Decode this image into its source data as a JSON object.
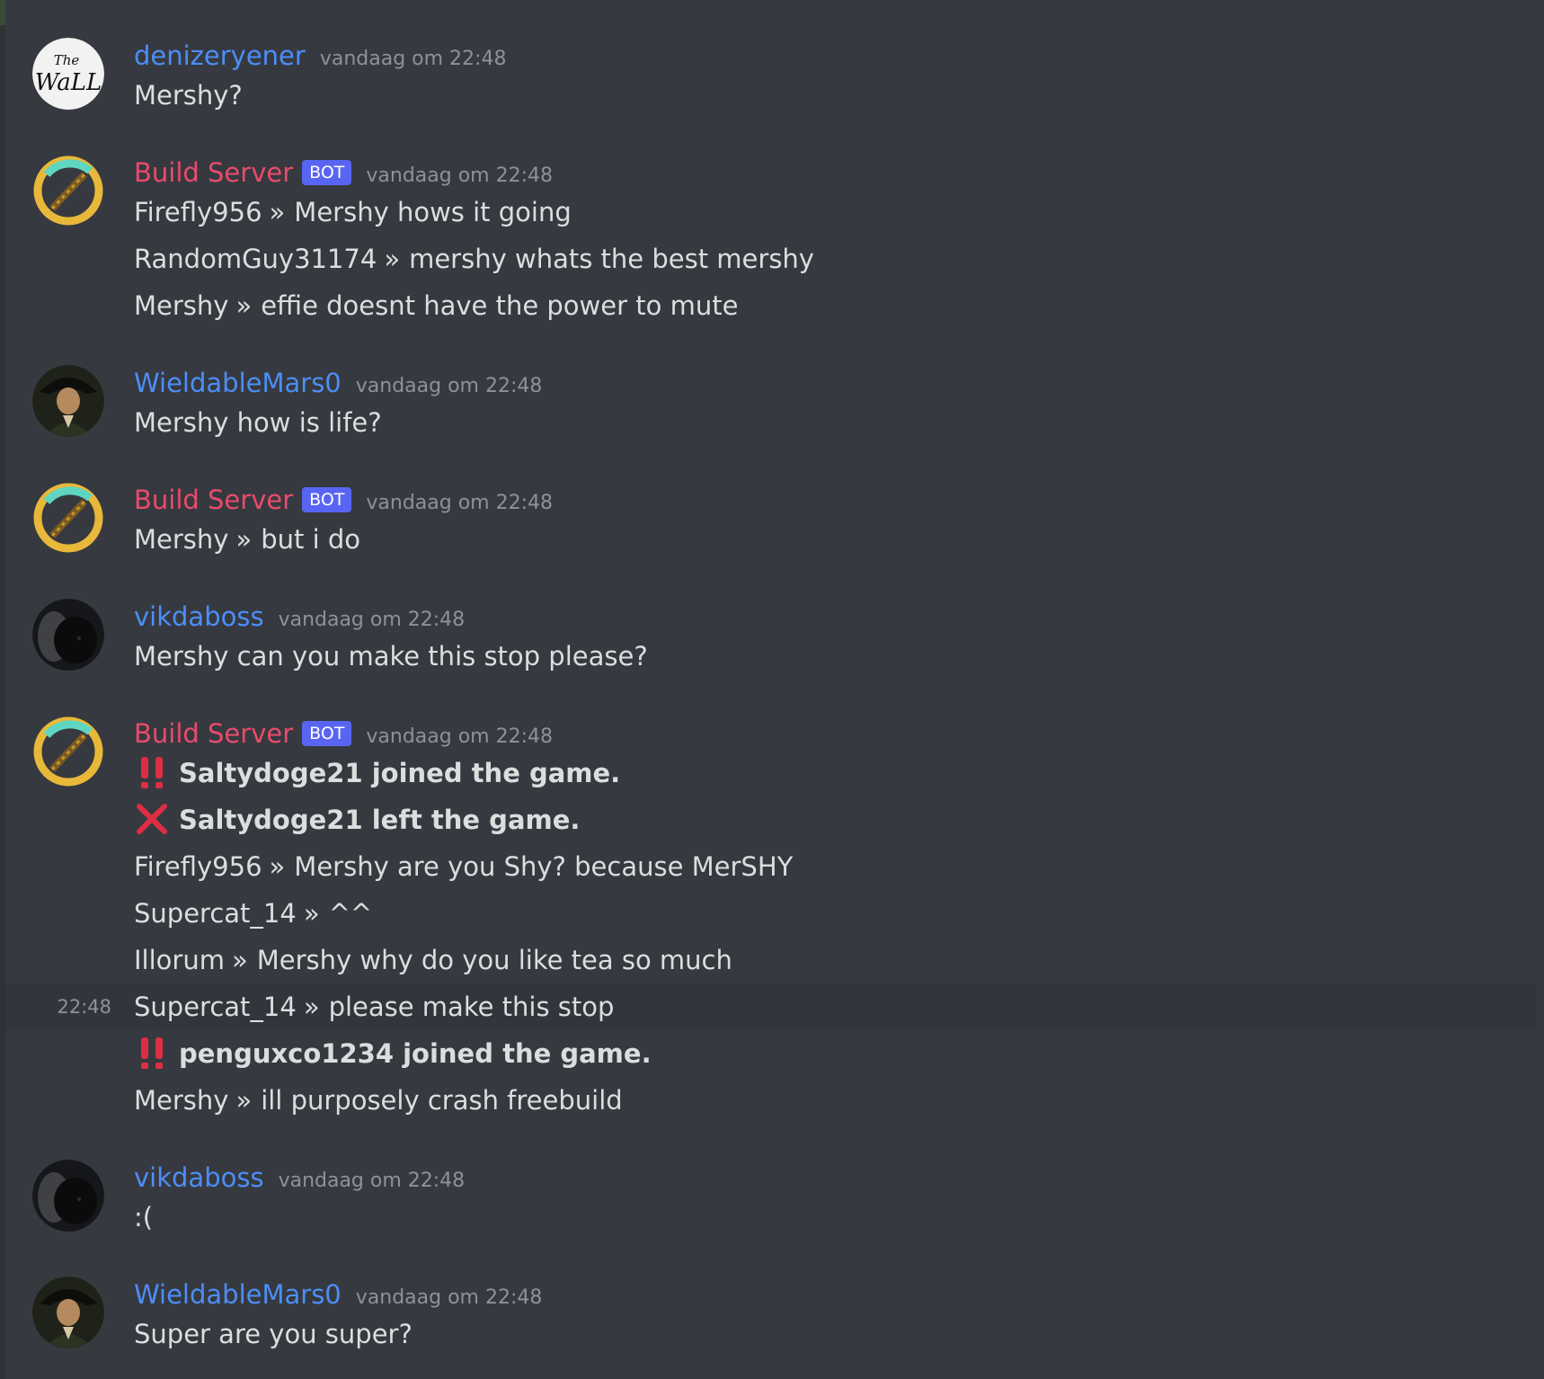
{
  "colors": {
    "background": "#36393f",
    "username_blue": "#4c8ef7",
    "username_pink": "#e94b6b",
    "bot_tag": "#5865f2",
    "timestamp": "#8e9297"
  },
  "groups": [
    {
      "username": "denizeryener",
      "avatar": "the-wall-avatar",
      "timestamp": "vandaag om 22:48",
      "lines": [
        {
          "text": "Mershy?"
        }
      ]
    },
    {
      "username": "Build Server",
      "bot_label": "BOT",
      "avatar": "pickaxe-avatar",
      "timestamp": "vandaag om 22:48",
      "lines": [
        {
          "author": "Firefly956",
          "sep": "»",
          "text": "Mershy hows it going"
        },
        {
          "author": "RandomGuy31174",
          "sep": "»",
          "text": "mershy whats the best mershy"
        },
        {
          "author": "Mershy",
          "sep": "»",
          "text": "effie doesnt have the power to mute"
        }
      ]
    },
    {
      "username": "WieldableMars0",
      "avatar": "pirate-captain-avatar",
      "timestamp": "vandaag om 22:48",
      "lines": [
        {
          "text": "Mershy how is life?"
        }
      ]
    },
    {
      "username": "Build Server",
      "bot_label": "BOT",
      "avatar": "pickaxe-avatar",
      "timestamp": "vandaag om 22:48",
      "lines": [
        {
          "author": "Mershy",
          "sep": "»",
          "text": "but i do"
        }
      ]
    },
    {
      "username": "vikdaboss",
      "avatar": "black-cat-avatar",
      "timestamp": "vandaag om 22:48",
      "lines": [
        {
          "text": "Mershy can you make this stop please?"
        }
      ]
    },
    {
      "username": "Build Server",
      "bot_label": "BOT",
      "avatar": "pickaxe-avatar",
      "timestamp": "vandaag om 22:48",
      "lines": [
        {
          "emoji": "double-exclamation-icon",
          "text": "Saltydoge21 joined the game."
        },
        {
          "emoji": "cross-mark-icon",
          "text": "Saltydoge21 left the game."
        },
        {
          "author": "Firefly956",
          "sep": "»",
          "text": "Mershy are you Shy? because MerSHY"
        },
        {
          "author": "Supercat_14",
          "sep": "»",
          "text": "^^"
        },
        {
          "author": "Illorum",
          "sep": "»",
          "text": "Mershy why do you like tea so much"
        },
        {
          "author": "Supercat_14",
          "sep": "»",
          "text": "please make this stop",
          "hover_time": "22:48"
        },
        {
          "emoji": "double-exclamation-icon",
          "text": "penguxco1234 joined the game."
        },
        {
          "author": "Mershy",
          "sep": "»",
          "text": "ill purposely crash freebuild"
        }
      ]
    },
    {
      "username": "vikdaboss",
      "avatar": "black-cat-avatar",
      "timestamp": "vandaag om 22:48",
      "lines": [
        {
          "text": ":("
        }
      ]
    },
    {
      "username": "WieldableMars0",
      "avatar": "pirate-captain-avatar",
      "timestamp": "vandaag om 22:48",
      "lines": [
        {
          "text": "Super are you super?"
        }
      ]
    }
  ]
}
